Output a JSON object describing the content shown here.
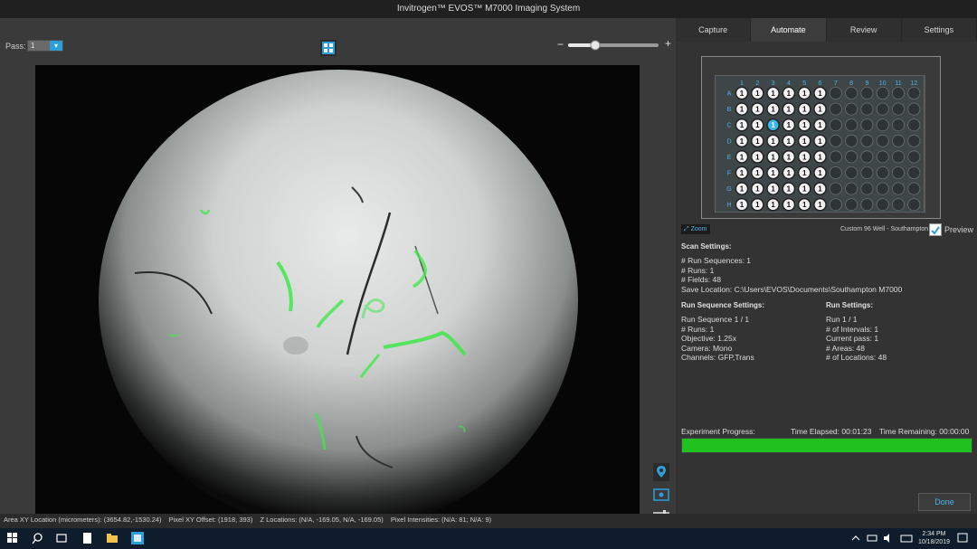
{
  "window": {
    "title": "Invitrogen™ EVOS™ M7000 Imaging System"
  },
  "viewer": {
    "pass_label": "Pass:",
    "pass_value": "1",
    "zoom_minus": "−",
    "zoom_plus": "+",
    "zoom_level": 0.3
  },
  "tabs": [
    {
      "label": "Capture"
    },
    {
      "label": "Automate",
      "active": true
    },
    {
      "label": "Review"
    },
    {
      "label": "Settings"
    }
  ],
  "plate": {
    "columns": [
      "1",
      "2",
      "3",
      "4",
      "5",
      "6",
      "7",
      "8",
      "9",
      "10",
      "11",
      "12"
    ],
    "rows": [
      "A",
      "B",
      "C",
      "D",
      "E",
      "F",
      "G",
      "H"
    ],
    "well_label": "1",
    "active_columns": 6,
    "selected_well": "C3",
    "name": "Custom 96 Well - Southampton",
    "zoom_label": "Zoom",
    "preview_label": "Preview"
  },
  "scan_settings": {
    "title": "Scan Settings:",
    "lines": [
      "# Run Sequences: 1",
      "# Runs: 1",
      "# Fields: 48",
      "Save Location: C:\\Users\\EVOS\\Documents\\Southampton M7000"
    ]
  },
  "run_sequence_settings": {
    "title": "Run Sequence Settings:",
    "lines": [
      "Run Sequence 1 / 1",
      "# Runs: 1",
      "Objective: 1.25x",
      "Camera: Mono",
      "Channels: GFP,Trans"
    ]
  },
  "run_settings": {
    "title": "Run Settings:",
    "lines": [
      "Run 1 / 1",
      "# of Intervals: 1",
      "Current pass: 1",
      "# Areas: 48",
      "# of Locations: 48"
    ]
  },
  "progress": {
    "label": "Experiment Progress:",
    "elapsed": "Time Elapsed: 00:01:23",
    "remaining": "Time Remaining: 00:00:00",
    "percent": 100
  },
  "done_label": "Done",
  "status": {
    "area": "Area XY Location (micrometers): (3654.82,-1530.24)",
    "pixel": "Pixel XY Offset: (1918, 393)",
    "z": "Z Locations: (N/A, -169.05, N/A, -169.05)",
    "intensity": "Pixel Intensities: (N/A: 81; N/A: 9)"
  },
  "taskbar": {
    "time": "2:34 PM",
    "date": "10/18/2019"
  },
  "colors": {
    "accent": "#2d9ed8",
    "progress": "#1fc21f",
    "gfp": "#3ee84a"
  }
}
